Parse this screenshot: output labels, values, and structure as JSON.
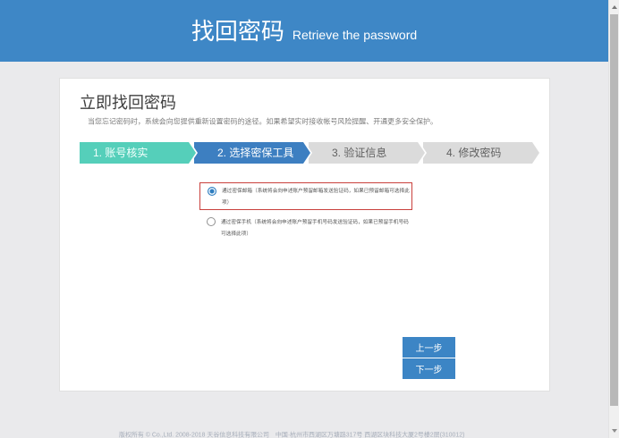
{
  "header": {
    "title": "找回密码",
    "subtitle": "Retrieve the password"
  },
  "card": {
    "title": "立即找回密码",
    "description": "当您忘记密码时，系统会向您提供重新设置密码的途径。如果希望实时接收帐号风险提醒、开通更多安全保护。",
    "steps": [
      {
        "label": "1. 账号核实",
        "status": "completed"
      },
      {
        "label": "2. 选择密保工具",
        "status": "current"
      },
      {
        "label": "3. 验证信息",
        "status": "upcoming"
      },
      {
        "label": "4. 修改密码",
        "status": "upcoming"
      }
    ],
    "options": [
      {
        "label": "通过密保邮箱（系统将会向申述账户预留邮箱发送验证码，如果已预留邮箱可选择此项）",
        "selected": true,
        "highlighted": true
      },
      {
        "label": "通过密保手机（系统将会向申述账户预留手机号码发送验证码，如果已预留手机号码可选择此项）",
        "selected": false,
        "highlighted": false
      }
    ],
    "buttons": {
      "previous": "上一步",
      "next": "下一步"
    }
  },
  "footer": {
    "copyright": "版权所有 © Co.,Ltd. 2008-2018 天谷信息科技有限公司　中国·杭州市西湖区万塘路317号 西湖区块科技大厦2号楼2层(310012)"
  },
  "colors": {
    "header_bg": "#3e87c6",
    "page_bg": "#eaeaec",
    "card_bg": "#ffffff",
    "step_completed": "#55cfba",
    "step_current": "#3d7fc1",
    "step_upcoming": "#dbdbdb",
    "highlight_border": "#c9403c",
    "radio_selected": "#2e7dbf",
    "button_bg": "#3c85c5",
    "footer_text": "#a7aeba"
  }
}
